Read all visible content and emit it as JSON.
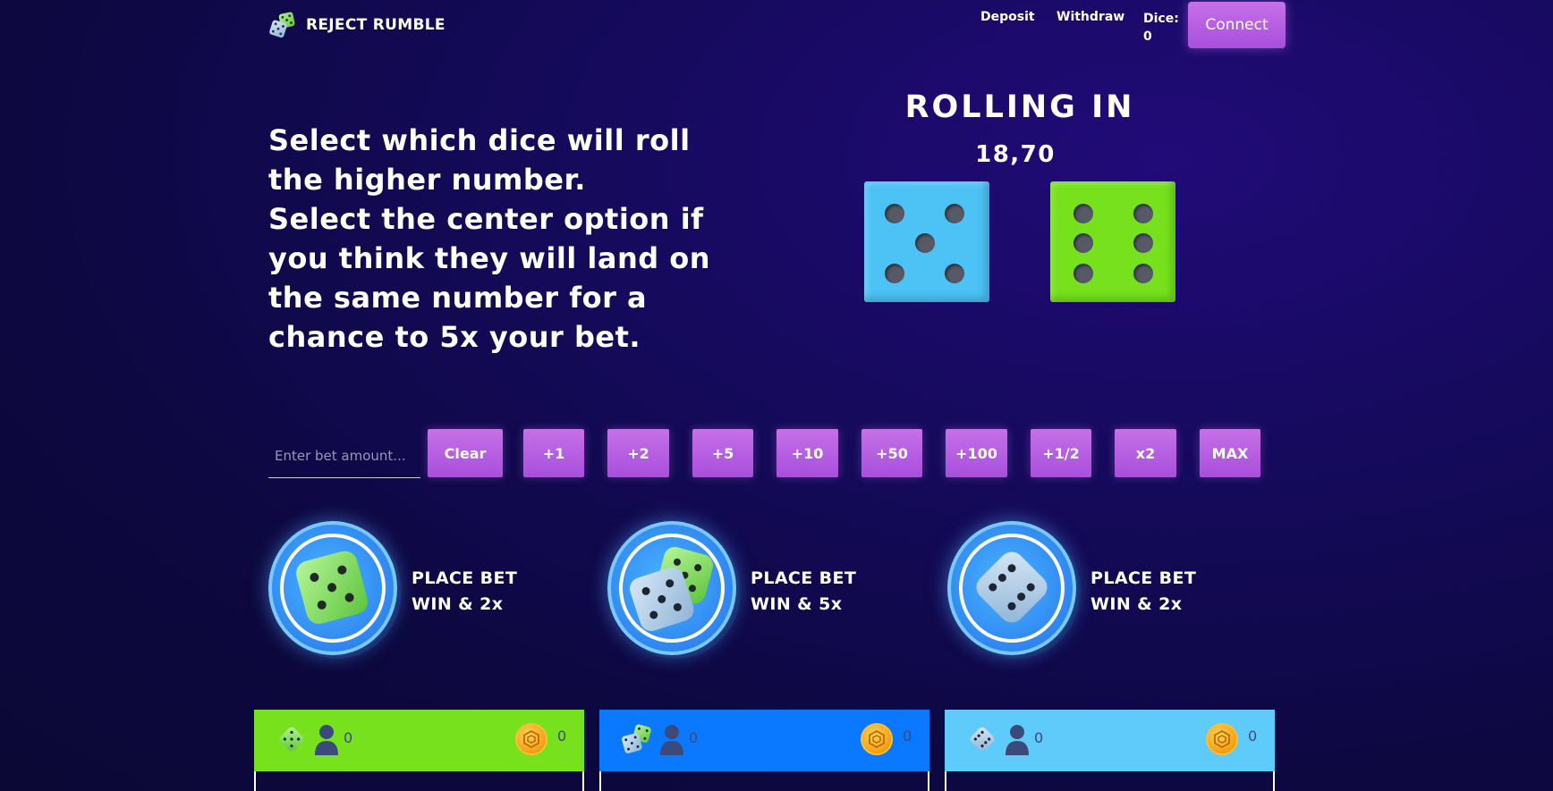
{
  "header": {
    "brand": "REJECT RUMBLE",
    "deposit": "Deposit",
    "withdraw": "Withdraw",
    "dice_label": "Dice:",
    "dice_value": "0",
    "connect": "Connect"
  },
  "instructions": {
    "line1": "Select which dice will roll the higher number.",
    "line2": "Select the center option if you think they will land on the same number for a chance to 5x your bet."
  },
  "rolling": {
    "title": "ROLLING IN",
    "timer": "18,70",
    "left_die": {
      "color": "#4cc2f5",
      "value": 5
    },
    "right_die": {
      "color": "#76e11c",
      "value": 6
    }
  },
  "bet": {
    "placeholder": "Enter bet amount...",
    "buttons": [
      "Clear",
      "+1",
      "+2",
      "+5",
      "+10",
      "+50",
      "+100",
      "+1/2",
      "x2",
      "MAX"
    ]
  },
  "options": [
    {
      "icon": "green-dice-icon",
      "label": "PLACE BET",
      "payout": "WIN & 2x"
    },
    {
      "icon": "blue-green-dice-icon",
      "label": "PLACE BET",
      "payout": "WIN & 5x"
    },
    {
      "icon": "blue-dice-icon",
      "label": "PLACE BET",
      "payout": "WIN & 2x"
    }
  ],
  "panels": [
    {
      "color": "#76e11c",
      "players": "0",
      "amount": "0",
      "icon": "green-dice-icon"
    },
    {
      "color": "#0a78ff",
      "players": "0",
      "amount": "0",
      "icon": "blue-green-dice-icon"
    },
    {
      "color": "#5ecbfa",
      "players": "0",
      "amount": "0",
      "icon": "blue-dice-icon"
    }
  ]
}
